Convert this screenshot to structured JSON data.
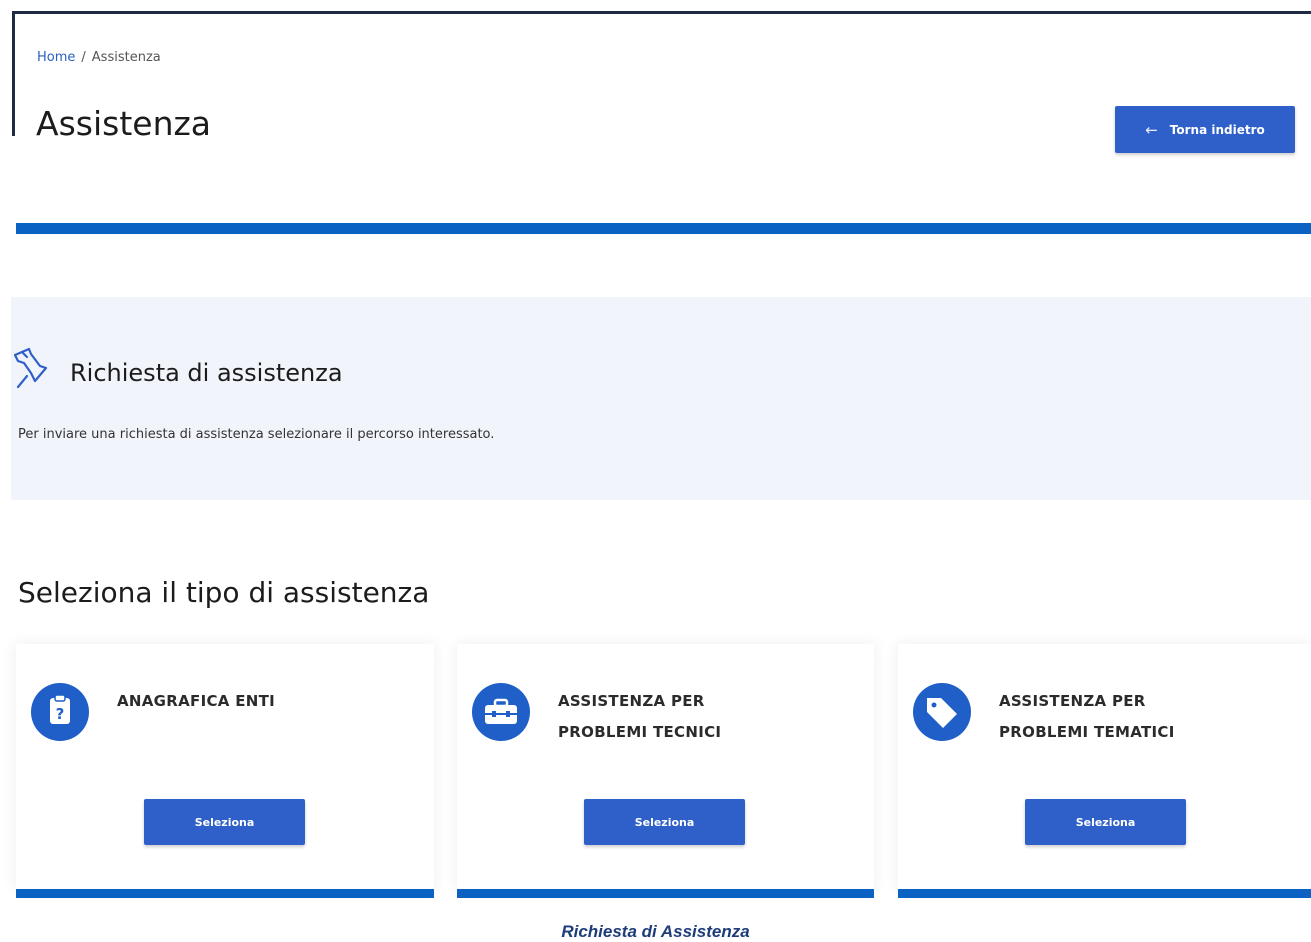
{
  "breadcrumb": {
    "home": "Home",
    "separator": "/",
    "current": "Assistenza"
  },
  "header": {
    "title": "Assistenza",
    "back_label": "Torna indietro"
  },
  "info": {
    "heading": "Richiesta di assistenza",
    "text": "Per inviare una richiesta di assistenza selezionare il percorso interessato."
  },
  "section": {
    "title": "Seleziona il tipo di assistenza"
  },
  "cards": [
    {
      "title": "ANAGRAFICA ENTI",
      "icon": "clipboard-question-icon",
      "button": "Seleziona"
    },
    {
      "title": "ASSISTENZA PER PROBLEMI TECNICI",
      "icon": "toolbox-icon",
      "button": "Seleziona"
    },
    {
      "title": "ASSISTENZA PER PROBLEMI TEMATICI",
      "icon": "tag-icon",
      "button": "Seleziona"
    }
  ],
  "caption": "Richiesta di Assistenza",
  "colors": {
    "primary": "#2f60c9",
    "band": "#0b62c2",
    "panel": "#f1f5fb"
  }
}
